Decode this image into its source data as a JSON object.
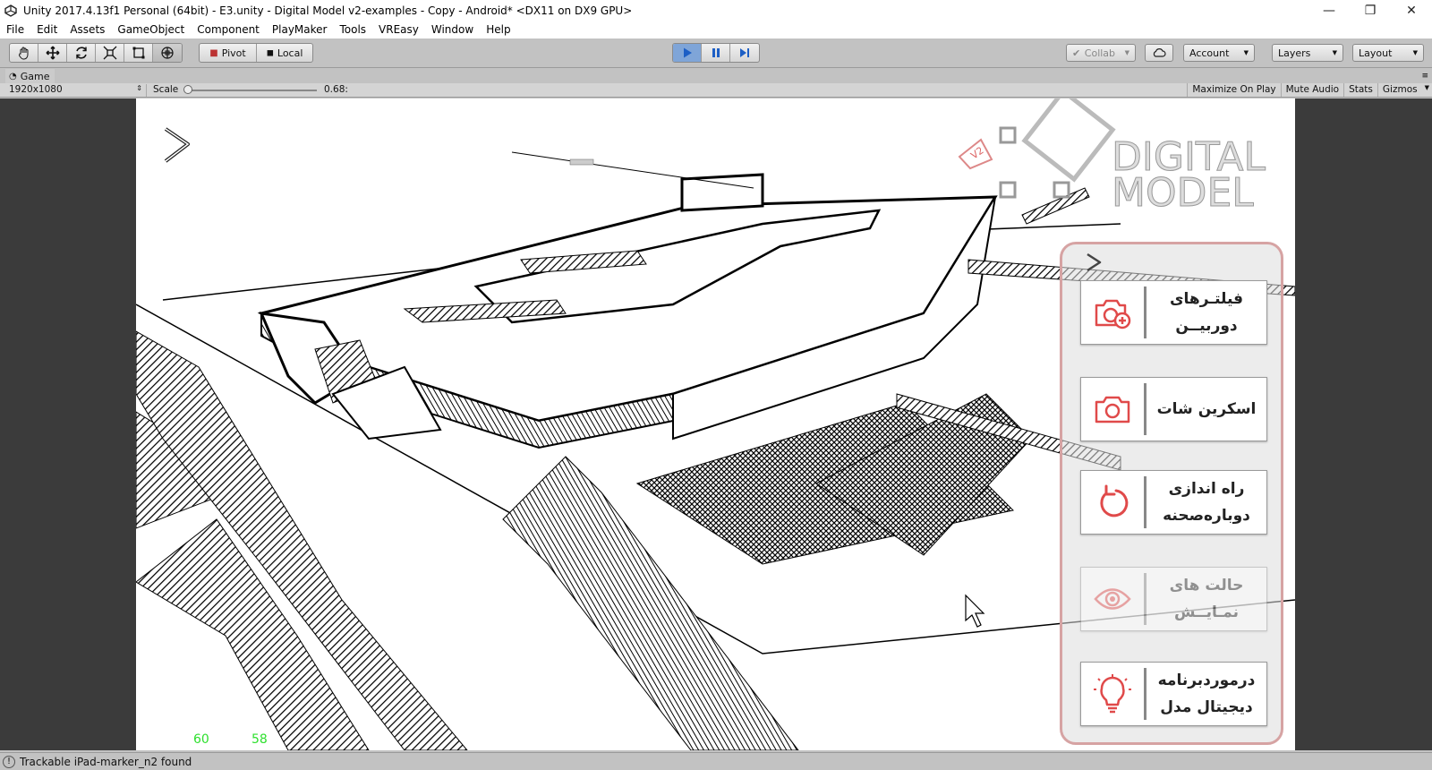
{
  "window": {
    "title": "Unity 2017.4.13f1 Personal (64bit) - E3.unity - Digital Model v2-examples - Copy - Android* <DX11 on DX9 GPU>",
    "minimize": "—",
    "restore": "❐",
    "close": "✕"
  },
  "menu": [
    "File",
    "Edit",
    "Assets",
    "GameObject",
    "Component",
    "PlayMaker",
    "Tools",
    "VREasy",
    "Window",
    "Help"
  ],
  "toolbar": {
    "pivot": "Pivot",
    "local": "Local",
    "collab": "Collab",
    "account": "Account",
    "layers": "Layers",
    "layout": "Layout"
  },
  "game": {
    "tab_label": "Game",
    "resolution": "1920x1080",
    "scale_label": "Scale",
    "scale_value": "0.68:",
    "maximize_on_play": "Maximize On Play",
    "mute_audio": "Mute Audio",
    "stats": "Stats",
    "gizmos": "Gizmos",
    "fps_a": "60",
    "fps_b": "58",
    "logo_line1": "DIGITAL",
    "logo_line2": "MODEL",
    "logo_tag": "V2"
  },
  "panel": {
    "buttons": [
      {
        "line1": "فیلتـرهای",
        "line2": "دوربیــن",
        "icon": "camera-plus-icon"
      },
      {
        "line1": "اسکرین شات",
        "line2": "",
        "icon": "camera-icon"
      },
      {
        "line1": "راه اندازی",
        "line2": "دوباره‌صحنه",
        "icon": "restart-icon"
      },
      {
        "line1": "حالت های",
        "line2": "نمـایــش",
        "icon": "eye-icon"
      },
      {
        "line1": "درمورد‌برنامه",
        "line2": "دیجیتال مدل",
        "icon": "lightbulb-icon"
      }
    ]
  },
  "status": {
    "message": "Trackable iPad-marker_n2 found"
  },
  "colors": {
    "accent_icon": "#e04a4a",
    "panel_border": "#d6a3a3",
    "play_active": "#7fa5d8",
    "fps": "#2ee02e"
  }
}
